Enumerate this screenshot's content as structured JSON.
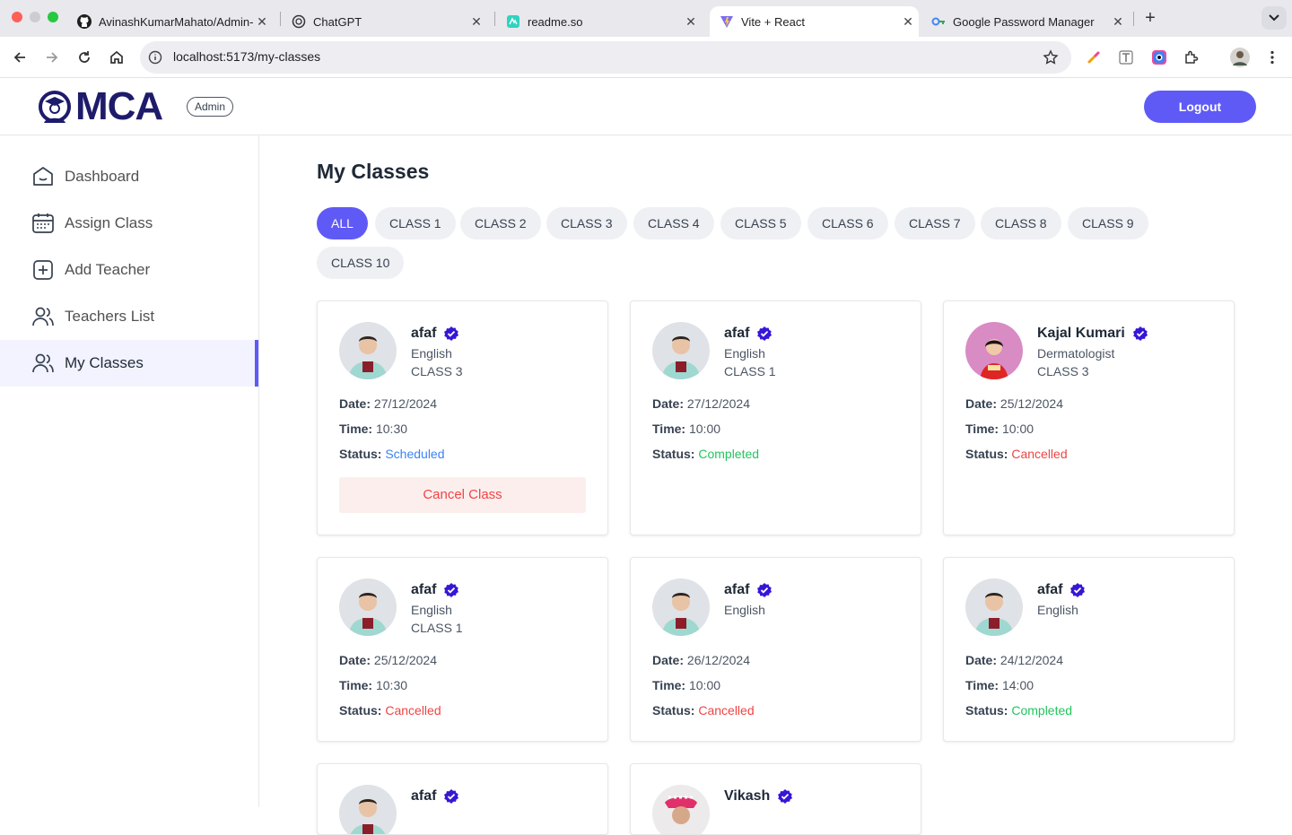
{
  "browser": {
    "tabs": [
      {
        "title": "AvinashKumarMahato/Admin-",
        "icon": "github-icon"
      },
      {
        "title": "ChatGPT",
        "icon": "chatgpt-icon"
      },
      {
        "title": "readme.so",
        "icon": "readme-icon"
      },
      {
        "title": "Vite + React",
        "icon": "vite-icon"
      },
      {
        "title": "Google Password Manager",
        "icon": "google-password-icon"
      }
    ],
    "url": "localhost:5173/my-classes"
  },
  "header": {
    "logo_text": "MCA",
    "badge": "Admin",
    "logout_label": "Logout",
    "accent": "#5f5af6",
    "logo_color": "#1e1b6b"
  },
  "sidebar": {
    "items": [
      {
        "label": "Dashboard",
        "icon": "home-icon"
      },
      {
        "label": "Assign Class",
        "icon": "calendar-icon"
      },
      {
        "label": "Add Teacher",
        "icon": "add-icon"
      },
      {
        "label": "Teachers List",
        "icon": "people-icon"
      },
      {
        "label": "My Classes",
        "icon": "people-icon",
        "active": true
      }
    ]
  },
  "main": {
    "title": "My Classes",
    "filters": [
      "ALL",
      "CLASS 1",
      "CLASS 2",
      "CLASS 3",
      "CLASS 4",
      "CLASS 5",
      "CLASS 6",
      "CLASS 7",
      "CLASS 8",
      "CLASS 9",
      "CLASS 10"
    ],
    "active_filter": "ALL",
    "labels": {
      "date": "Date:",
      "time": "Time:",
      "status": "Status:",
      "cancel": "Cancel Class"
    },
    "cards": [
      {
        "name": "afaf",
        "subject": "English",
        "class": "CLASS 3",
        "date": "27/12/2024",
        "time": "10:30",
        "status": "Scheduled"
      },
      {
        "name": "afaf",
        "subject": "English",
        "class": "CLASS 1",
        "date": "27/12/2024",
        "time": "10:00",
        "status": "Completed"
      },
      {
        "name": "Kajal Kumari",
        "subject": "Dermatologist",
        "class": "CLASS 3",
        "date": "25/12/2024",
        "time": "10:00",
        "status": "Cancelled"
      },
      {
        "name": "afaf",
        "subject": "English",
        "class": "CLASS 1",
        "date": "25/12/2024",
        "time": "10:30",
        "status": "Cancelled"
      },
      {
        "name": "afaf",
        "subject": "English",
        "class": "",
        "date": "26/12/2024",
        "time": "10:00",
        "status": "Cancelled"
      },
      {
        "name": "afaf",
        "subject": "English",
        "class": "",
        "date": "24/12/2024",
        "time": "14:00",
        "status": "Completed"
      },
      {
        "name": "afaf"
      },
      {
        "name": "Vikash"
      }
    ],
    "status_colors": {
      "Scheduled": "#3b82f6",
      "Completed": "#22c55e",
      "Cancelled": "#ef4444"
    }
  }
}
